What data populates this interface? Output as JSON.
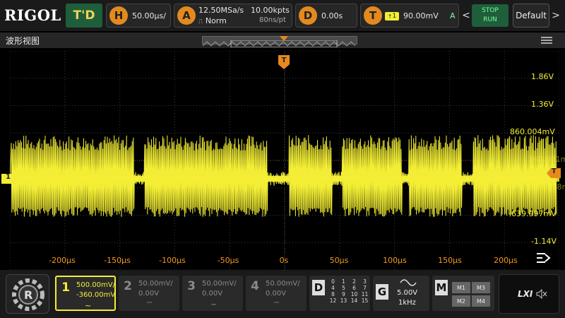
{
  "topbar": {
    "brand": "RIGOL",
    "mode": "T'D",
    "horizontal": {
      "icon": "H",
      "value": "50.00μs/"
    },
    "acquire": {
      "icon": "A",
      "sample_rate": "12.50MSa/s",
      "mode": "Norm",
      "points": "10.00kpts",
      "time_per_pt": "80ns/pt"
    },
    "delay": {
      "icon": "D",
      "value": "0.00s"
    },
    "trigger": {
      "icon": "T",
      "source": "1",
      "level": "90.00mV",
      "mode": "A"
    },
    "prev_arrow": "<",
    "stop_label": "STOP",
    "run_label": "RUN",
    "default_label": "Default",
    "next_arrow": ">"
  },
  "window": {
    "title": "波形视图",
    "trigger_marker": "T",
    "channel_marker": "1",
    "right_trigger_marker": "T"
  },
  "screen": {
    "y_labels": [
      "1.86V",
      "1.36V",
      "860.004mV",
      "-639.997mV",
      "-1.14V"
    ],
    "x_labels": [
      "-200μs",
      "-150μs",
      "-100μs",
      "-50μs",
      "0s",
      "50μs",
      "100μs",
      "150μs",
      "200μs"
    ],
    "overlap_labels": [
      "360.001mV",
      "-139.998mV"
    ],
    "colors": {
      "trace": "#f3ee35",
      "axis_labels": "#f39a1e",
      "grid": "#3c3c3c",
      "marker": "#e8891c"
    }
  },
  "channels": [
    {
      "num": "1",
      "scale": "500.00mV/",
      "offset": "-360.00mV",
      "coupling": "~",
      "color": "#f3ee35",
      "active": true
    },
    {
      "num": "2",
      "scale": "50.00mV/",
      "offset": "0.00V",
      "coupling": "⎓",
      "color": "#8a8a8a",
      "active": false
    },
    {
      "num": "3",
      "scale": "50.00mV/",
      "offset": "0.00V",
      "coupling": "~",
      "color": "#8a8a8a",
      "active": false
    },
    {
      "num": "4",
      "scale": "50.00mV/",
      "offset": "0.00V",
      "coupling": "⎓",
      "color": "#8a8a8a",
      "active": false
    }
  ],
  "digital": {
    "letter": "D",
    "channels": [
      "0",
      "1",
      "2",
      "3",
      "4",
      "5",
      "6",
      "7",
      "8",
      "9",
      "10",
      "11",
      "12",
      "13",
      "14",
      "15"
    ]
  },
  "generator": {
    "letter": "G",
    "amplitude": "5.00V",
    "frequency": "1kHz",
    "icon": "sine-wave-icon"
  },
  "math": {
    "letter": "M",
    "items": [
      "M1",
      "M3",
      "M2",
      "M4"
    ]
  },
  "lxi": {
    "label": "LXI"
  }
}
